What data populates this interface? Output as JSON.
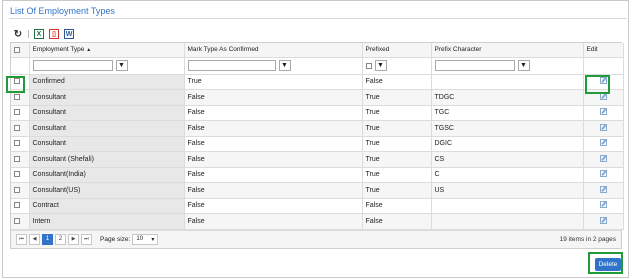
{
  "title": "List Of Employment Types",
  "toolbar": {
    "icons": [
      "refresh-icon",
      "excel-icon",
      "pdf-icon",
      "word-icon"
    ]
  },
  "columns": {
    "employment_type": "Employment Type",
    "mark_type": "Mark Type As Confirmed",
    "prefixed": "Prefixed",
    "prefix_character": "Prefix Character",
    "edit": "Edit"
  },
  "sort_indicator": "▲",
  "filter_icon": "▼",
  "rows": [
    {
      "employment_type": "Confirmed",
      "mark_type": "True",
      "prefixed": "False",
      "prefix": ""
    },
    {
      "employment_type": "Consultant",
      "mark_type": "False",
      "prefixed": "True",
      "prefix": "TDGC"
    },
    {
      "employment_type": "Consultant",
      "mark_type": "False",
      "prefixed": "True",
      "prefix": "TGC"
    },
    {
      "employment_type": "Consultant",
      "mark_type": "False",
      "prefixed": "True",
      "prefix": "TGSC"
    },
    {
      "employment_type": "Consultant",
      "mark_type": "False",
      "prefixed": "True",
      "prefix": "DGIC"
    },
    {
      "employment_type": "Consultant (Shefali)",
      "mark_type": "False",
      "prefixed": "True",
      "prefix": "CS"
    },
    {
      "employment_type": "Consultant(India)",
      "mark_type": "False",
      "prefixed": "True",
      "prefix": "C"
    },
    {
      "employment_type": "Consultant(US)",
      "mark_type": "False",
      "prefixed": "True",
      "prefix": "US"
    },
    {
      "employment_type": "Contract",
      "mark_type": "False",
      "prefixed": "False",
      "prefix": ""
    },
    {
      "employment_type": "Intern",
      "mark_type": "False",
      "prefixed": "False",
      "prefix": ""
    }
  ],
  "pager": {
    "first": "⏮",
    "prev": "◀",
    "pages": [
      "1",
      "2"
    ],
    "current_page": "1",
    "next": "▶",
    "last": "⏭",
    "page_size_label": "Page size:",
    "page_size": "10",
    "info": "19 items in 2 pages"
  },
  "delete_label": "Delete",
  "colors": {
    "accent": "#2f74c9",
    "highlight": "#1f9b3a"
  }
}
